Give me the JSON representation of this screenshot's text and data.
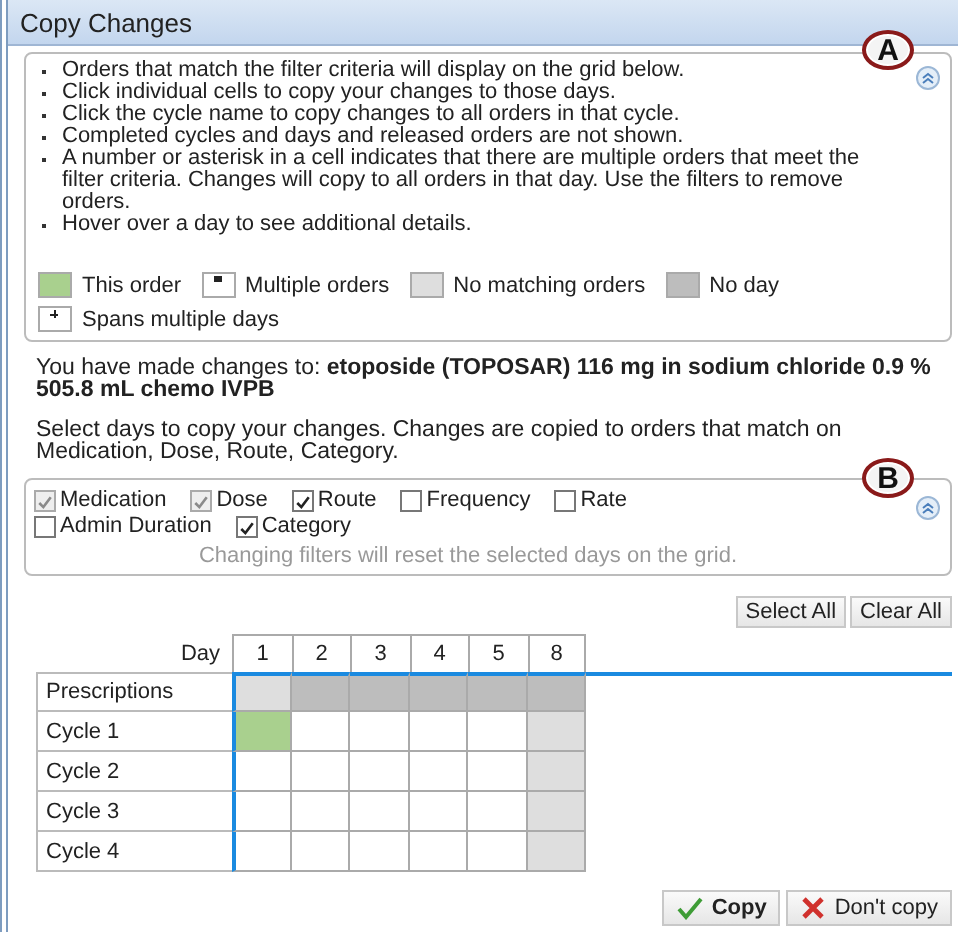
{
  "window": {
    "title": "Copy Changes"
  },
  "instructions": {
    "callout": "A",
    "collapsed": false,
    "bullets": [
      "Orders that match the filter criteria will display on the grid below.",
      "Click individual cells to copy your changes to those days.",
      "Click the cycle name to copy changes to all orders in that cycle.",
      "Completed cycles and days and released orders are not shown.",
      "A number or asterisk in a cell indicates that there are multiple orders that meet the filter criteria. Changes will copy to all orders in that day. Use the filters to remove orders.",
      "Hover over a day to see additional details."
    ],
    "legend": [
      {
        "kind": "this",
        "label": "This order"
      },
      {
        "kind": "multiple",
        "label": "Multiple orders"
      },
      {
        "kind": "none",
        "label": "No matching orders"
      },
      {
        "kind": "noday",
        "label": "No day"
      },
      {
        "kind": "spans",
        "label": "Spans multiple days"
      }
    ]
  },
  "changes_text": "You have made changes to: **etoposide (TOPOSAR) 116 mg in sodium chloride 0.9 % 505.8 mL chemo IVPB**",
  "select_text": "Select days to copy your changes. Changes are copied to orders that match on Medication, Dose, Route, Category.",
  "filters": {
    "callout": "B",
    "collapsed": false,
    "options": [
      {
        "label": "Medication",
        "checked": true,
        "disabled": true
      },
      {
        "label": "Dose",
        "checked": true,
        "disabled": true
      },
      {
        "label": "Route",
        "checked": true,
        "disabled": false
      },
      {
        "label": "Frequency",
        "checked": false,
        "disabled": false
      },
      {
        "label": "Rate",
        "checked": false,
        "disabled": false
      },
      {
        "label": "Admin Duration",
        "checked": false,
        "disabled": false
      },
      {
        "label": "Category",
        "checked": true,
        "disabled": false
      }
    ],
    "note": "Changing filters will reset the selected days on the grid."
  },
  "grid_buttons": [
    "Select All",
    "Clear All"
  ],
  "grid": {
    "corner": "Day",
    "days": [
      "1",
      "2",
      "3",
      "4",
      "5",
      "8"
    ],
    "rows": [
      {
        "label": "Prescriptions",
        "cells": [
          {
            "kind": "none"
          },
          {
            "kind": "noday"
          },
          {
            "kind": "noday"
          },
          {
            "kind": "noday"
          },
          {
            "kind": "noday"
          },
          {
            "kind": "noday"
          }
        ]
      },
      {
        "label": "Cycle 1",
        "cells": [
          {
            "kind": "this"
          },
          {
            "kind": "empty"
          },
          {
            "kind": "empty"
          },
          {
            "kind": "empty"
          },
          {
            "kind": "empty"
          },
          {
            "kind": "none"
          }
        ]
      },
      {
        "label": "Cycle 2",
        "cells": [
          {
            "kind": "empty"
          },
          {
            "kind": "empty"
          },
          {
            "kind": "empty"
          },
          {
            "kind": "empty"
          },
          {
            "kind": "empty"
          },
          {
            "kind": "none"
          }
        ]
      },
      {
        "label": "Cycle 3",
        "cells": [
          {
            "kind": "empty"
          },
          {
            "kind": "empty"
          },
          {
            "kind": "empty"
          },
          {
            "kind": "empty"
          },
          {
            "kind": "empty"
          },
          {
            "kind": "none"
          }
        ]
      },
      {
        "label": "Cycle 4",
        "cells": [
          {
            "kind": "empty"
          },
          {
            "kind": "empty"
          },
          {
            "kind": "empty"
          },
          {
            "kind": "empty"
          },
          {
            "kind": "empty"
          },
          {
            "kind": "none"
          }
        ]
      }
    ]
  },
  "buttons": [
    {
      "kind": "copy",
      "label": "Copy"
    },
    {
      "kind": "cancel",
      "label": "Don't copy"
    }
  ]
}
